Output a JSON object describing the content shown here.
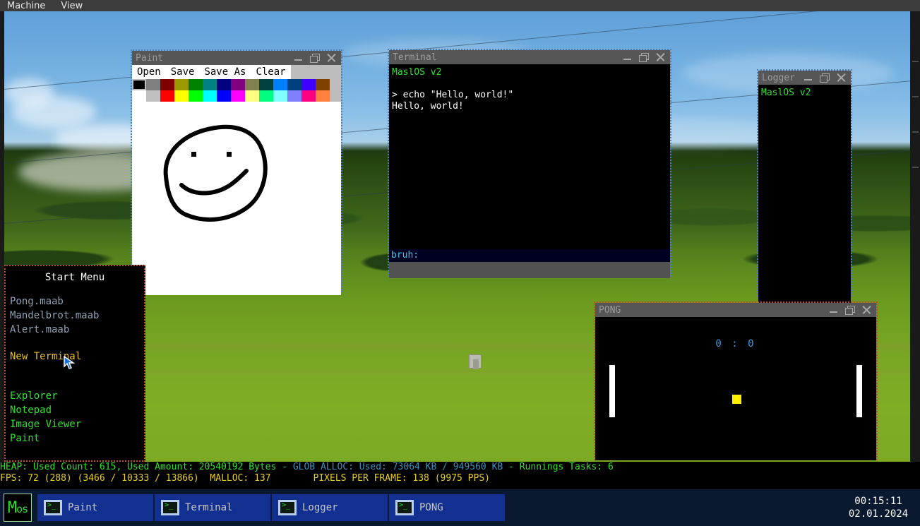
{
  "vm_menu": {
    "items": [
      "Machine",
      "View"
    ]
  },
  "window_controls": {
    "minimize": "minimize-icon",
    "maximize": "maximize-icon",
    "close": "close-icon"
  },
  "paint": {
    "title": "Paint",
    "menu": [
      "Open",
      "Save",
      "Save As",
      "Clear"
    ],
    "palette_row1": [
      "#000000",
      "#808080",
      "#800000",
      "#9a9a00",
      "#008000",
      "#008080",
      "#000080",
      "#800080",
      "#808050",
      "#004040",
      "#0080ff",
      "#004080",
      "#4000ff",
      "#804000"
    ],
    "palette_row2": [
      "#ffffff",
      "#c0c0c0",
      "#ff0000",
      "#ffff00",
      "#00ff00",
      "#00ffff",
      "#0000ff",
      "#ff00ff",
      "#ffff80",
      "#00ff80",
      "#80ffff",
      "#8080ff",
      "#ff0080",
      "#ff8040"
    ],
    "selected_color": "#000000",
    "canvas_content": "hand-drawn-smiley-face"
  },
  "terminal": {
    "title": "Terminal",
    "header": "MaslOS v2",
    "lines": [
      "> echo \"Hello, world!\"",
      "Hello, world!"
    ],
    "prompt": "bruh:",
    "prompt_value": ""
  },
  "logger": {
    "title": "Logger",
    "lines": [
      "MaslOS v2"
    ]
  },
  "pong": {
    "title": "PONG",
    "score_left": "0",
    "score_right": "0",
    "score_separator": ":"
  },
  "start_menu": {
    "title": "Start Menu",
    "files": [
      "Pong.maab",
      "Mandelbrot.maab",
      "Alert.maab"
    ],
    "actions": [
      "New Terminal"
    ],
    "apps": [
      "Explorer",
      "Notepad",
      "Image Viewer",
      "Paint"
    ]
  },
  "status": {
    "line1_heap": "HEAP: Used Count: 615, Used Amount: 20540192 Bytes",
    "line1_sep": " - ",
    "line1_glob": "GLOB ALLOC: Used: 73064 KB / 949560 KB",
    "line1_sep2": " - ",
    "line1_tasks": "Runnings Tasks: 6",
    "line2_fps": "FPS: 72 (288) (3466 / 10333 / 13866)  MALLOC: 137",
    "line2_pixels": "PIXELS PER FRAME: 138 (9975 PPS)"
  },
  "taskbar": {
    "start_logo_big": "M",
    "start_logo_small": "os",
    "tasks": [
      "Paint",
      "Terminal",
      "Logger",
      "PONG"
    ],
    "clock_time": "00:15:11",
    "clock_date": "02.01.2024"
  },
  "colors": {
    "accent_green": "#2fe02f",
    "taskbar_blue": "#12308f",
    "titlebar_gray": "#565656",
    "focus_border": "#c0502a",
    "ball_yellow": "#ffee00"
  }
}
